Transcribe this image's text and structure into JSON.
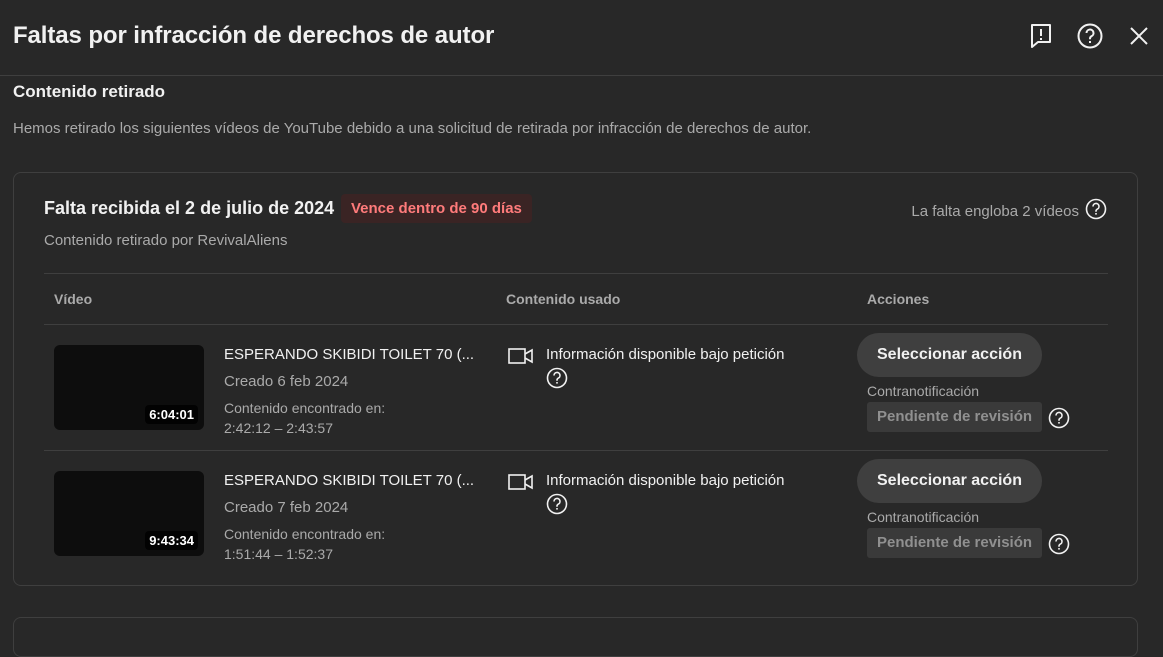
{
  "dialog": {
    "title": "Faltas por infracción de derechos de autor",
    "icons": [
      "feedback-icon",
      "help-icon",
      "close-icon"
    ]
  },
  "section": {
    "title": "Contenido retirado",
    "description": "Hemos retirado los siguientes vídeos de YouTube debido a una solicitud de retirada por infracción de derechos de autor."
  },
  "strike": {
    "title": "Falta recibida el 2 de julio de 2024",
    "expiry_badge": "Vence dentro de 90 días",
    "removed_by": "Contenido retirado por RevivalAliens",
    "covers": "La falta engloba 2 vídeos",
    "columns": {
      "video": "Vídeo",
      "content_used": "Contenido usado",
      "actions": "Acciones"
    },
    "rows": [
      {
        "duration": "6:04:01",
        "title": "ESPERANDO SKIBIDI TOILET 70 (...",
        "created": "Creado 6 feb 2024",
        "found_label": "Contenido encontrado en:",
        "found_range": "2:42:12 – 2:43:57",
        "content_used": "Información disponible bajo petición",
        "action_button": "Seleccionar acción",
        "counter_label": "Contranotificación",
        "counter_status": "Pendiente de revisión"
      },
      {
        "duration": "9:43:34",
        "title": "ESPERANDO SKIBIDI TOILET 70 (...",
        "created": "Creado 7 feb 2024",
        "found_label": "Contenido encontrado en:",
        "found_range": "1:51:44 – 1:52:37",
        "content_used": "Información disponible bajo petición",
        "action_button": "Seleccionar acción",
        "counter_label": "Contranotificación",
        "counter_status": "Pendiente de revisión"
      }
    ]
  },
  "colors": {
    "background": "#282828",
    "border": "#3f3f3f",
    "badge_text": "#ff7b7b",
    "badge_bg": "#3a2424"
  }
}
